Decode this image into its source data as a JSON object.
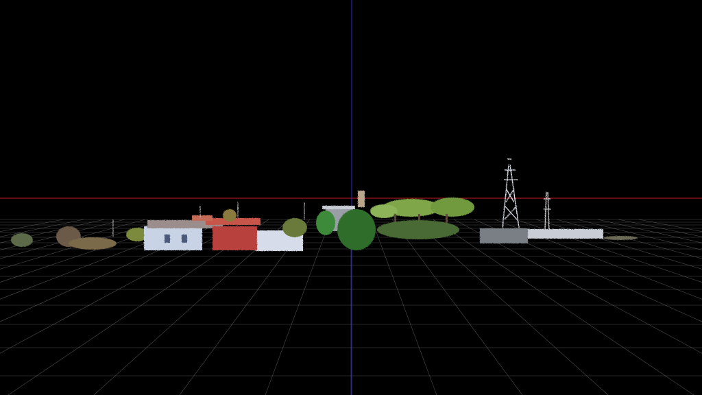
{
  "viewer": {
    "background_color": "#000000",
    "grid_color": "#8c8c8c",
    "x_axis_color": "#c81e1e",
    "y_axis_color": "#2830c8"
  },
  "scene": {
    "content": "point-cloud",
    "objects": [
      {
        "name": "building-white",
        "color": "#c9d3e6"
      },
      {
        "name": "building-red",
        "color": "#b8413c"
      },
      {
        "name": "pine-tree-canopy",
        "color": "#5f8f3a"
      },
      {
        "name": "transmission-tower",
        "color": "#d8dde6"
      },
      {
        "name": "antenna-mast",
        "color": "#c7c7c7"
      },
      {
        "name": "low-vegetation",
        "color": "#6b7a40"
      }
    ]
  }
}
